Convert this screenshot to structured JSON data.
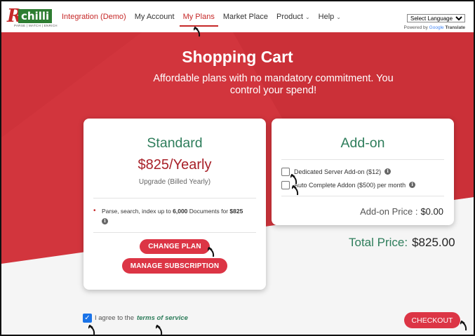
{
  "logo": {
    "text": "chilli",
    "tagline": "PARSE | MATCH | ENRICH"
  },
  "nav": {
    "brand": "Integration (Demo)",
    "items": [
      {
        "label": "My Account"
      },
      {
        "label": "My Plans"
      },
      {
        "label": "Market Place"
      },
      {
        "label": "Product"
      },
      {
        "label": "Help"
      }
    ]
  },
  "language": {
    "selected": "Select Language",
    "powered_by": "Powered by",
    "google": "Google",
    "translate": "Translate"
  },
  "hero": {
    "title": "Shopping Cart",
    "subtitle": "Affordable plans with no mandatory commitment. You control your spend!"
  },
  "plan": {
    "name": "Standard",
    "price": "$825/Yearly",
    "billing": "Upgrade (Billed Yearly)",
    "feature_pre": "Parse, search, index up to ",
    "feature_count": "6,000",
    "feature_mid": " Documents for ",
    "feature_price": "$825",
    "change_label": "CHANGE PLAN",
    "manage_label": "MANAGE SUBSCRIPTION"
  },
  "addon": {
    "title": "Add-on",
    "options": [
      {
        "label": "Dedicated Server Add-on ($12)",
        "checked": false
      },
      {
        "label": "Auto Complete Addon ($500) per month",
        "checked": false
      }
    ],
    "price_label": "Add-on Price :",
    "price_value": "$0.00"
  },
  "total": {
    "label": "Total Price:",
    "value": "$825.00"
  },
  "terms": {
    "prefix": "I agree to the",
    "link": "terms of service",
    "checked": true
  },
  "checkout_label": "CHECKOUT",
  "colors": {
    "brand_red": "#d0343c",
    "accent_green": "#2e7d5b",
    "button_red": "#dc3545"
  }
}
